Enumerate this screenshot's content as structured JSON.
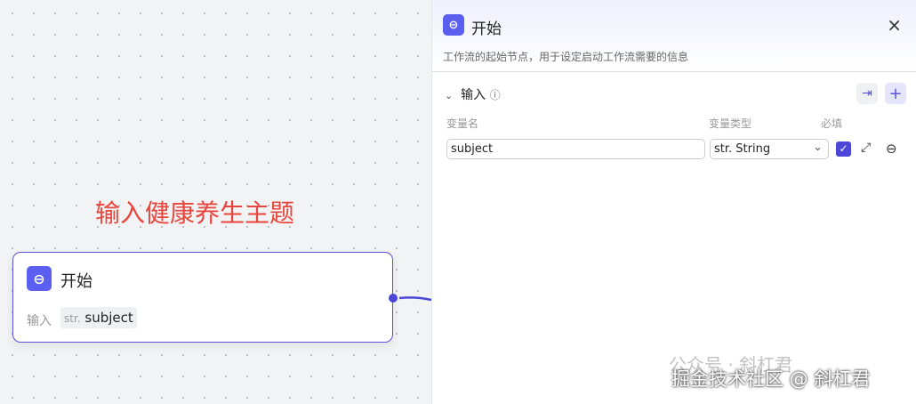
{
  "canvas": {
    "annotation": "输入健康养生主题",
    "node": {
      "title": "开始",
      "input_label": "输入",
      "tag_type": "str.",
      "tag_name": "subject"
    }
  },
  "panel": {
    "title": "开始",
    "description": "工作流的起始节点，用于设定启动工作流需要的信息",
    "close_icon": "×",
    "section": {
      "label": "输入",
      "columns": {
        "name": "变量名",
        "type": "变量类型",
        "required": "必填"
      },
      "rows": [
        {
          "name": "subject",
          "type": "str. String",
          "required": true
        }
      ]
    }
  },
  "watermark": {
    "line1": "公众号 · 斜杠君",
    "line2": "掘金技术社区 @ 斜杠君"
  },
  "colors": {
    "accent": "#5b52d6",
    "annotation": "#e8453c"
  }
}
